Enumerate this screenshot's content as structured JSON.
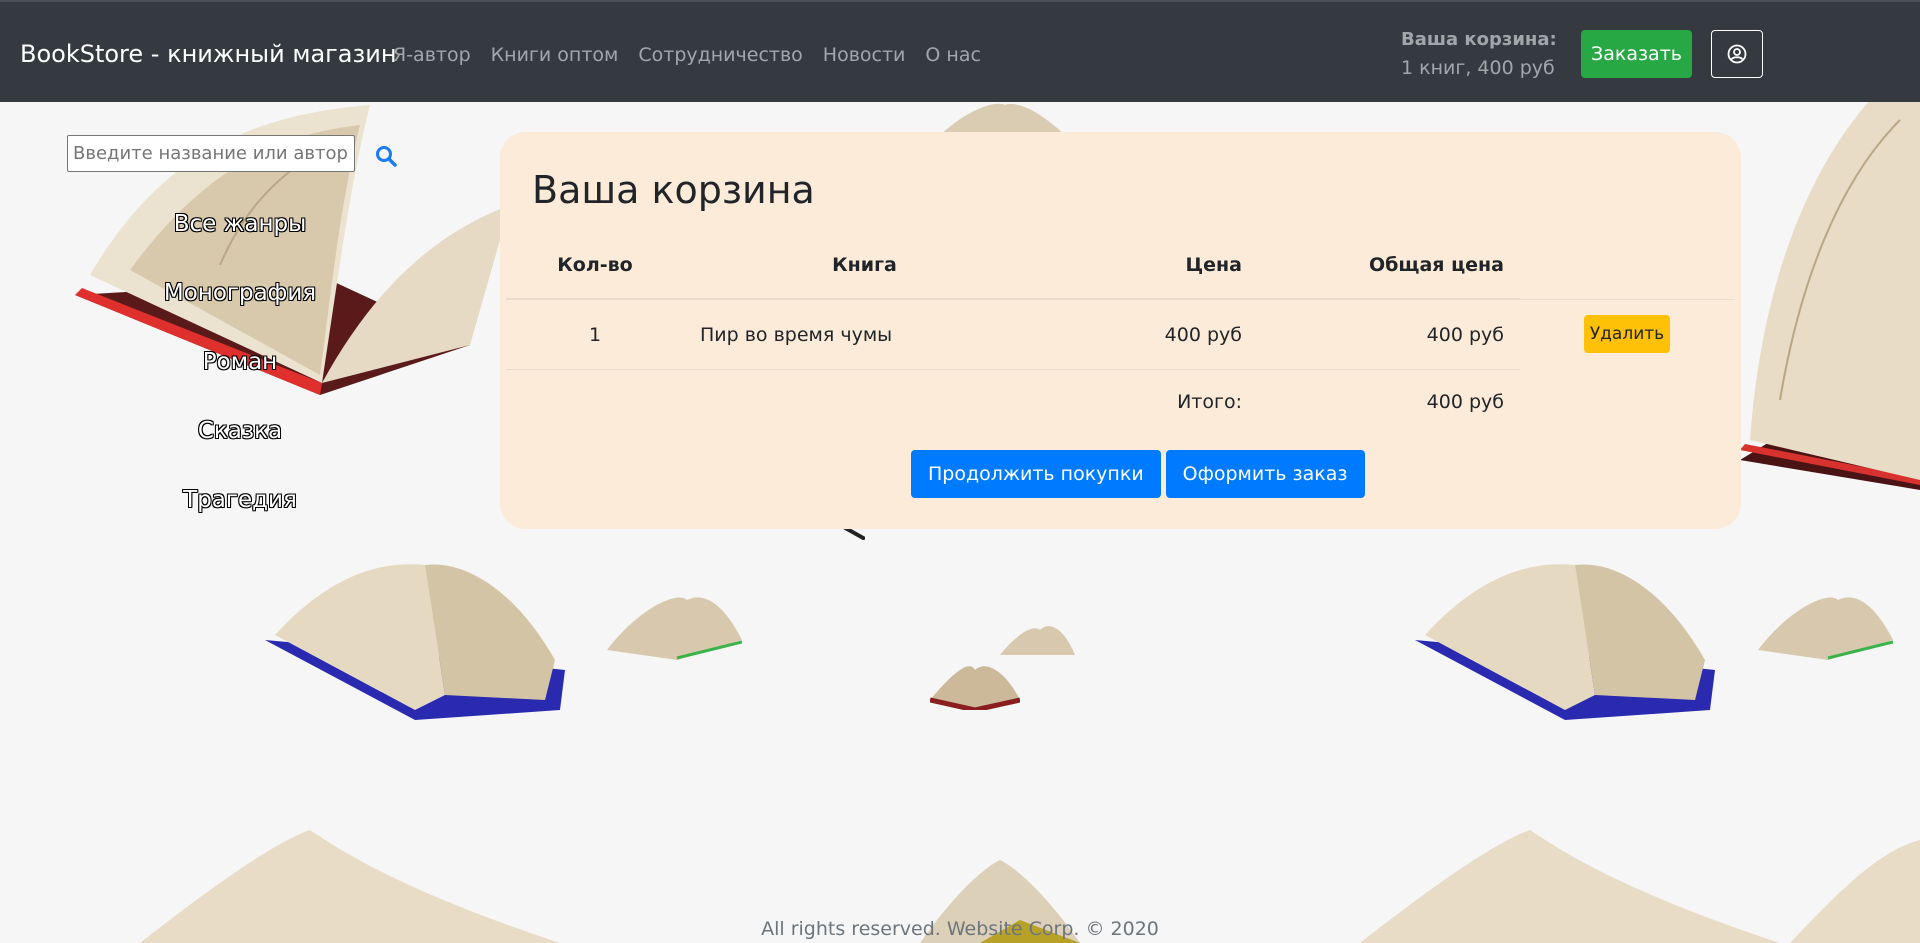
{
  "navbar": {
    "brand": "BookStore - книжный магазин",
    "links": [
      "Я-автор",
      "Книги оптом",
      "Сотрудничество",
      "Новости",
      "О нас"
    ],
    "cart_title": "Ваша корзина:",
    "cart_info": "1 книг, 400 руб",
    "order_label": "Заказать",
    "user_icon": "user-circle-icon"
  },
  "sidebar": {
    "search_placeholder": "Введите название или автора",
    "search_icon": "search-icon",
    "genres": [
      "Все жанры",
      "Монография",
      "Роман",
      "Сказка",
      "Трагедия"
    ]
  },
  "cart": {
    "title": "Ваша корзина",
    "columns": {
      "qty": "Кол-во",
      "book": "Книга",
      "price": "Цена",
      "total": "Общая цена"
    },
    "items": [
      {
        "qty": "1",
        "book": "Пир во время чумы",
        "price": "400 руб",
        "total": "400 руб",
        "delete_label": "Удалить"
      }
    ],
    "total_label": "Итого:",
    "total_value": "400 руб",
    "continue_label": "Продолжить покупки",
    "checkout_label": "Оформить заказ"
  },
  "footer": {
    "text": "All rights reserved. Website Corp. © 2020"
  },
  "colors": {
    "navbar": "#343a40",
    "success": "#28a745",
    "primary": "#007bff",
    "warning": "#ffc107",
    "card": "#fbebd8"
  }
}
